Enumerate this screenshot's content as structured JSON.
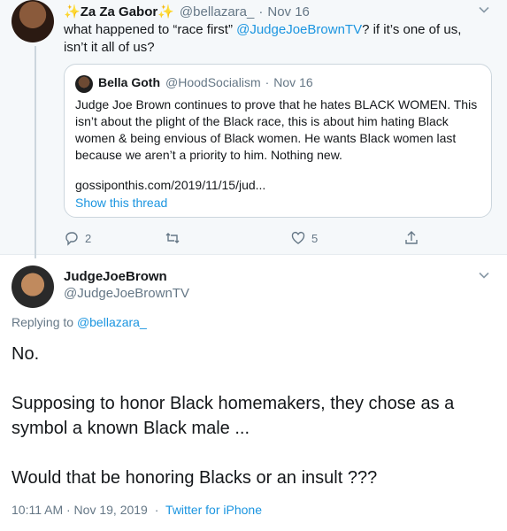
{
  "parent_tweet": {
    "spark_left": "✨",
    "name": "Za Za Gabor",
    "spark_right": "✨",
    "handle": "@bellazara_",
    "separator": "·",
    "date": "Nov 16",
    "text_before": "what happened to “race first” ",
    "mention": "@JudgeJoeBrownTV",
    "text_after": "? if it’s one of us, isn’t it all of us?",
    "quoted": {
      "name": "Bella Goth",
      "handle": "@HoodSocialism",
      "separator": "·",
      "date": "Nov 16",
      "text": "Judge Joe Brown continues to prove that he hates BLACK WOMEN. This isn’t about the plight of the Black race, this is about him hating Black women & being envious of Black women. He wants Black women last because we aren’t a priority to him. Nothing new.",
      "url": "gossiponthis.com/2019/11/15/jud...",
      "show_thread": "Show this thread"
    },
    "actions": {
      "reply_count": "2",
      "retweet_count": "",
      "like_count": "5"
    }
  },
  "main_tweet": {
    "name": "JudgeJoeBrown",
    "handle": "@JudgeJoeBrownTV",
    "replying_prefix": "Replying to ",
    "replying_handle": "@bellazara_",
    "line1": "No.",
    "line2": "Supposing to honor Black homemakers, they chose as a symbol a known Black male ...",
    "line3": "Would that be honoring Blacks or an insult ???",
    "timestamp": "10:11 AM · Nov 19, 2019",
    "separator": "·",
    "source": "Twitter for iPhone"
  },
  "icons": {
    "more": "chevron-down-icon",
    "reply": "reply-icon",
    "retweet": "retweet-icon",
    "like": "heart-icon",
    "share": "share-icon"
  },
  "colors": {
    "link": "#1b95e0",
    "secondary": "#657786",
    "parent_bg": "#f5f8fa"
  }
}
